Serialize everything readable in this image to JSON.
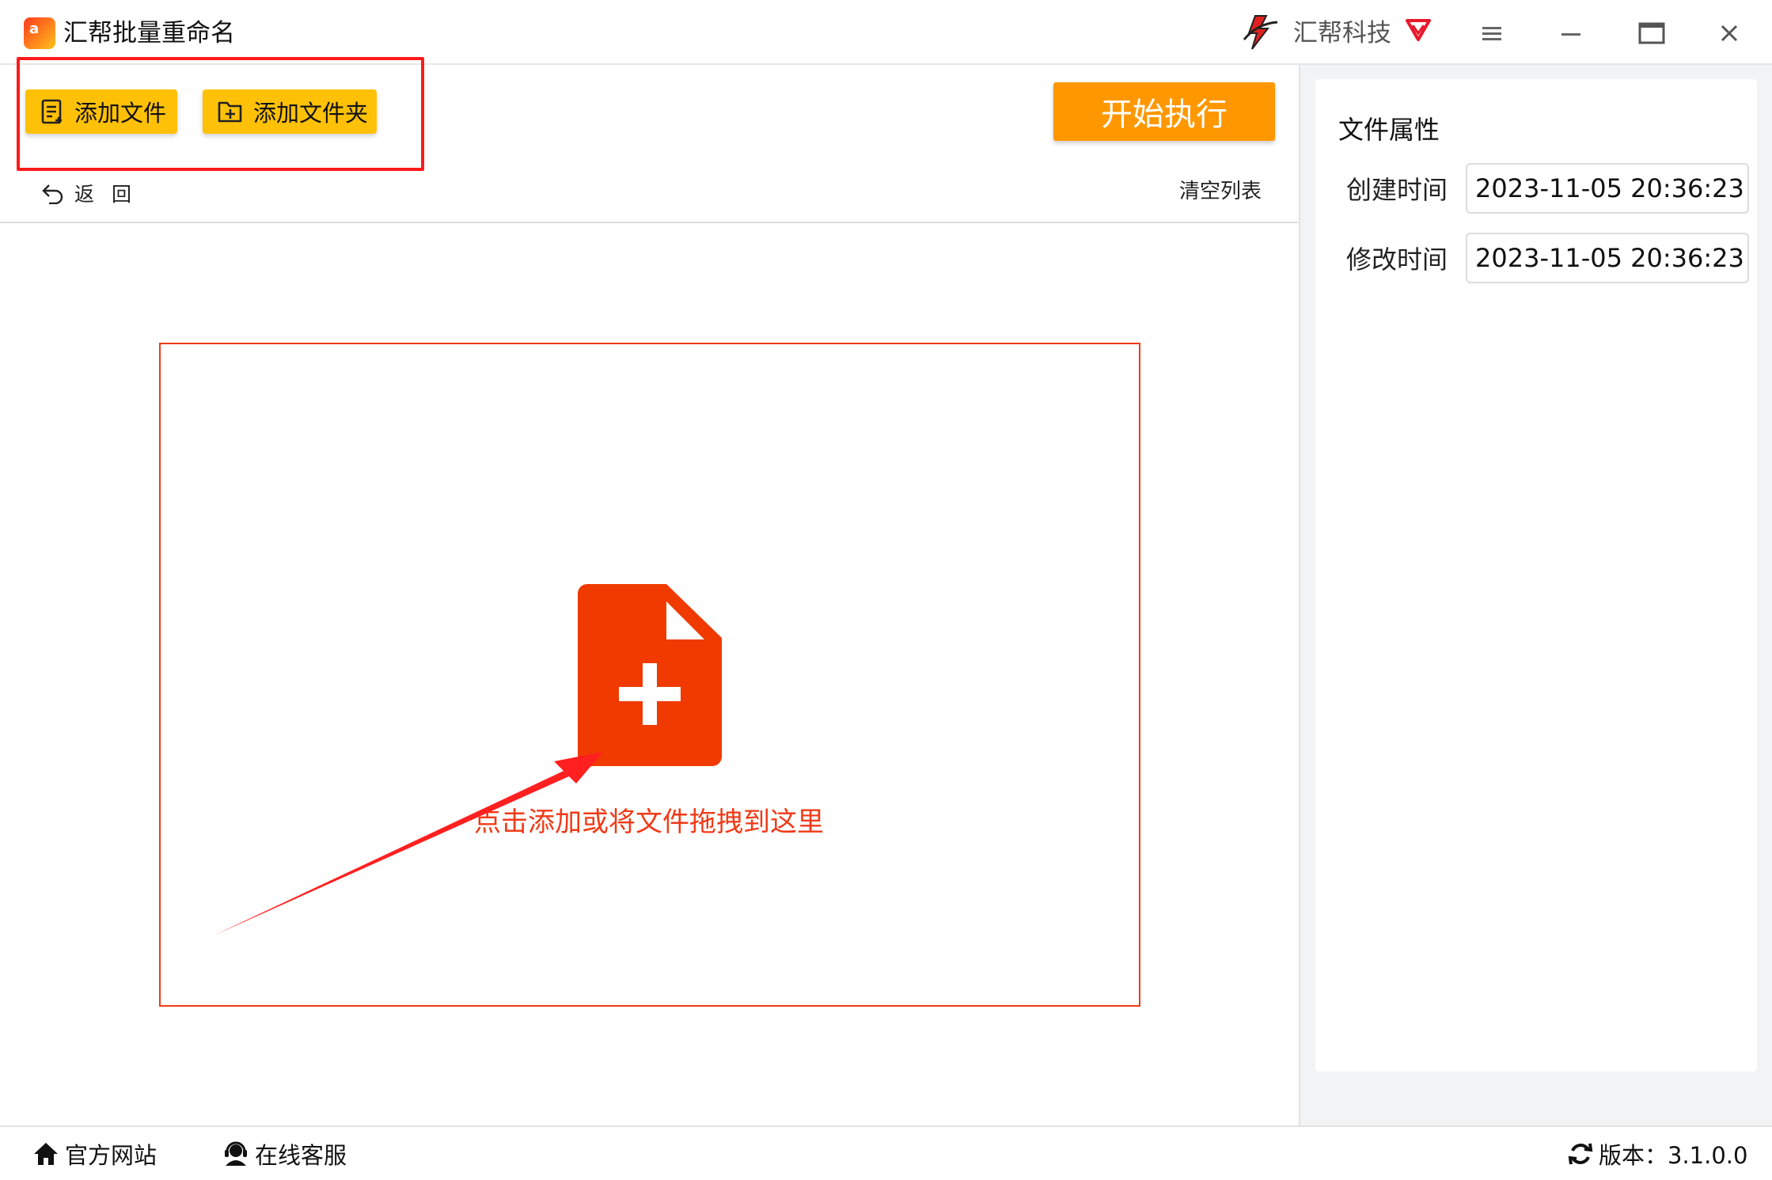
{
  "window": {
    "title": "汇帮批量重命名",
    "brand": "汇帮科技",
    "logo_text": "a"
  },
  "toolbar": {
    "add_file": "添加文件",
    "add_folder": "添加文件夹",
    "start": "开始执行",
    "back": "返回",
    "clear_list": "清空列表"
  },
  "drop_zone": {
    "hint": "点击添加或将文件拖拽到这里"
  },
  "properties": {
    "title": "文件属性",
    "created_label": "创建时间",
    "created_value": "2023-11-05 20:36:23",
    "modified_label": "修改时间",
    "modified_value": "2023-11-05 20:36:23"
  },
  "status_bar": {
    "official_site": "官方网站",
    "online_service": "在线客服",
    "version": "版本：3.1.0.0"
  },
  "colors": {
    "accent_yellow": "#ffc107",
    "accent_orange": "#ff9800",
    "drop_red": "#f03a17",
    "highlight_red": "#ff1a1a"
  },
  "icons": {
    "app_logo": "app-logo-icon",
    "brand_logo": "brand-logo-icon",
    "vip": "vip-diamond-icon",
    "menu": "hamburger-icon",
    "minimize": "minimize-icon",
    "maximize": "maximize-icon",
    "close": "close-icon",
    "add_file": "file-list-icon",
    "add_folder": "folder-plus-icon",
    "back": "undo-icon",
    "drop": "file-plus-icon",
    "home": "home-icon",
    "service": "headset-icon",
    "refresh": "refresh-icon"
  }
}
